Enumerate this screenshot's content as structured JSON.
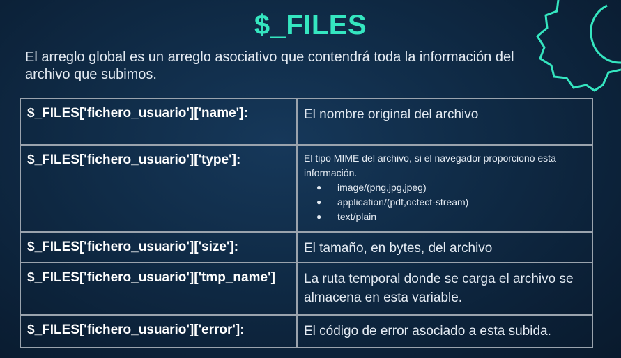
{
  "title": "$_FILES",
  "intro": "El arreglo global es un arreglo asociativo que  contendrá toda la información del archivo que subimos.",
  "rows": [
    {
      "key": "$_FILES['fichero_usuario']['name']:",
      "desc": "El nombre original del archivo"
    },
    {
      "key": "$_FILES['fichero_usuario']['type']:",
      "desc": "El tipo MIME del archivo, si el navegador proporcionó esta información.",
      "items": [
        "image/(png,jpg,jpeg)",
        "application/(pdf,octect-stream)",
        "text/plain"
      ]
    },
    {
      "key": "$_FILES['fichero_usuario']['size']:",
      "desc": " El tamaño, en bytes, del archivo"
    },
    {
      "key": "$_FILES['fichero_usuario']['tmp_name']",
      "desc": "La ruta temporal donde se carga el archivo se almacena en esta variable."
    },
    {
      "key": "$_FILES['fichero_usuario']['error']:",
      "desc": "El código de error asociado a esta subida."
    }
  ],
  "colors": {
    "accent": "#35e6c0",
    "background": "#0f2a45",
    "border": "#9aa3ad"
  },
  "decoration": {
    "icon": "gear-icon"
  }
}
